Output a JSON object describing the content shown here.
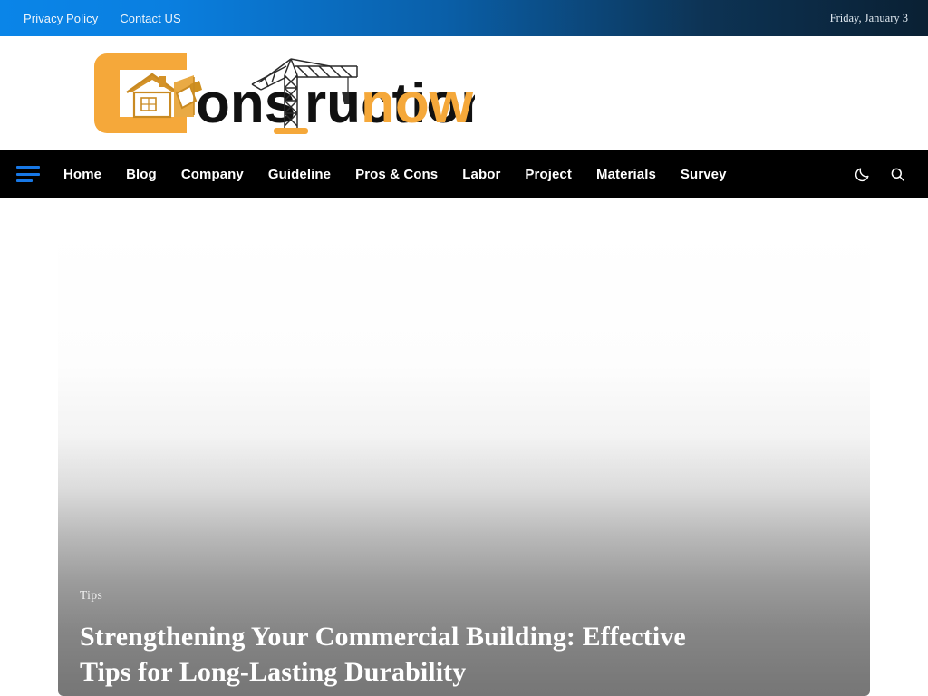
{
  "topbar": {
    "links": [
      {
        "label": "Privacy Policy"
      },
      {
        "label": "Contact US"
      }
    ],
    "date": "Friday, January 3",
    "gradient_from": "#0a85e8",
    "gradient_to": "#0a2033"
  },
  "logo": {
    "text_primary": "onstruction",
    "text_accent": "now",
    "initial": "C",
    "accent_color": "#f5a83a",
    "dark_color": "#111111",
    "icons": [
      "house-icon",
      "paint-roller-icon",
      "tower-crane-icon"
    ]
  },
  "nav": {
    "menu_icon": "hamburger-menu-icon",
    "menu_icon_color": "#1878e6",
    "items": [
      {
        "label": "Home"
      },
      {
        "label": "Blog"
      },
      {
        "label": "Company"
      },
      {
        "label": "Guideline"
      },
      {
        "label": "Pros & Cons"
      },
      {
        "label": "Labor"
      },
      {
        "label": "Project"
      },
      {
        "label": "Materials"
      },
      {
        "label": "Survey"
      }
    ],
    "actions": [
      {
        "icon": "moon-icon",
        "label": "Switch to dark mode"
      },
      {
        "icon": "search-icon",
        "label": "Search"
      }
    ],
    "background": "#000000"
  },
  "hero": {
    "category": "Tips",
    "title": "Strengthening Your Commercial Building: Effective Tips for Long-Lasting Durability"
  }
}
